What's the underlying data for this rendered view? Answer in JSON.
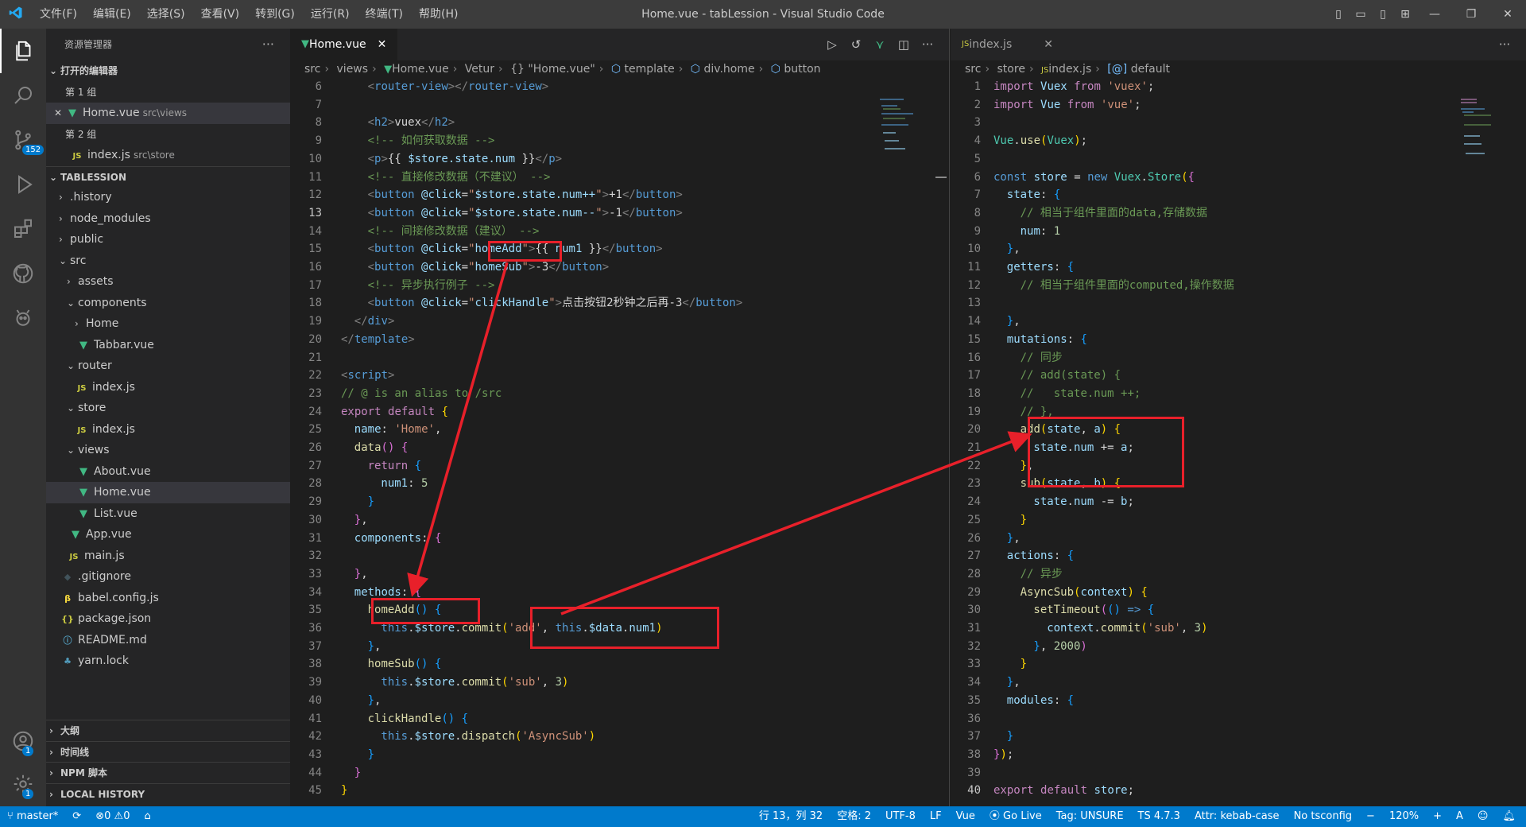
{
  "titlebar": {
    "title": "Home.vue - tabLession - Visual Studio Code",
    "menu": [
      "文件(F)",
      "编辑(E)",
      "选择(S)",
      "查看(V)",
      "转到(G)",
      "运行(R)",
      "终端(T)",
      "帮助(H)"
    ]
  },
  "activity": {
    "scm_badge": "152",
    "accounts_badge": "1",
    "settings_badge": "1"
  },
  "sidebar": {
    "header": "资源管理器",
    "open_editors": "打开的编辑器",
    "group1": "第 1 组",
    "group1_file": "Home.vue",
    "group1_desc": "src\\views",
    "group2": "第 2 组",
    "group2_file": "index.js",
    "group2_desc": "src\\store",
    "project": "TABLESSION",
    "tree": [
      ".history",
      "node_modules",
      "public",
      "src",
      "assets",
      "components",
      "Home",
      "Tabbar.vue",
      "router",
      "index.js",
      "store",
      "index.js",
      "views",
      "About.vue",
      "Home.vue",
      "List.vue",
      "App.vue",
      "main.js",
      ".gitignore",
      "babel.config.js",
      "package.json",
      "README.md",
      "yarn.lock"
    ],
    "sections": [
      "大纲",
      "时间线",
      "NPM 脚本",
      "LOCAL HISTORY"
    ]
  },
  "left_editor": {
    "tab": "Home.vue",
    "breadcrumbs": [
      "src",
      "views",
      "Home.vue",
      "Vetur",
      "{} \"Home.vue\"",
      "template",
      "div.home",
      "button"
    ],
    "line_numbers": [
      "6",
      "7",
      "8",
      "9",
      "10",
      "11",
      "12",
      "13",
      "14",
      "15",
      "16",
      "17",
      "18",
      "19",
      "20",
      "21",
      "22",
      "23",
      "24",
      "25",
      "26",
      "27",
      "28",
      "29",
      "30",
      "31",
      "32",
      "33",
      "34",
      "35",
      "36",
      "37",
      "38",
      "39",
      "40",
      "41",
      "42",
      "43",
      "44",
      "45"
    ]
  },
  "right_editor": {
    "tab": "index.js",
    "breadcrumbs": [
      "src",
      "store",
      "index.js",
      "default"
    ],
    "line_numbers": [
      "1",
      "2",
      "3",
      "4",
      "5",
      "6",
      "7",
      "8",
      "9",
      "10",
      "11",
      "12",
      "13",
      "14",
      "15",
      "16",
      "17",
      "18",
      "19",
      "20",
      "21",
      "22",
      "23",
      "24",
      "25",
      "26",
      "27",
      "28",
      "29",
      "30",
      "31",
      "32",
      "33",
      "34",
      "35",
      "36",
      "37",
      "38",
      "39",
      "40"
    ]
  },
  "statusbar": {
    "branch": "master*",
    "errors": "0",
    "warnings": "0",
    "position": "行 13，列 32",
    "spaces": "空格: 2",
    "encoding": "UTF-8",
    "eol": "LF",
    "language": "Vue",
    "golive": "Go Live",
    "tag": "Tag: UNSURE",
    "ts": "TS 4.7.3",
    "attr": "Attr: kebab-case",
    "tsconfig": "No tsconfig",
    "zoom": "120%",
    "plus": "+"
  }
}
